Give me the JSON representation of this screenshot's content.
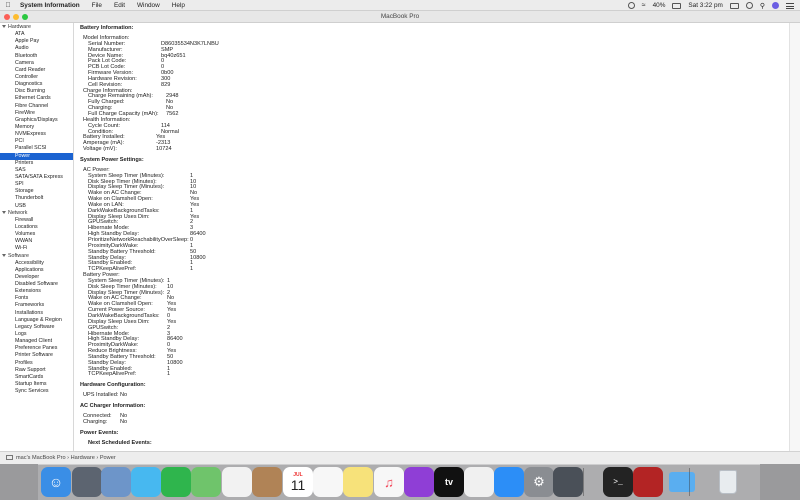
{
  "menubar": {
    "apple": "",
    "app_name": "System Information",
    "menus": [
      "File",
      "Edit",
      "Window",
      "Help"
    ],
    "battery": "40%",
    "clock": "Sat 3:22 pm"
  },
  "window": {
    "title": "MacBook Pro"
  },
  "sidebar": [
    {
      "label": "Hardware",
      "type": "group"
    },
    {
      "label": "ATA"
    },
    {
      "label": "Apple Pay"
    },
    {
      "label": "Audio"
    },
    {
      "label": "Bluetooth"
    },
    {
      "label": "Camera"
    },
    {
      "label": "Card Reader"
    },
    {
      "label": "Controller"
    },
    {
      "label": "Diagnostics"
    },
    {
      "label": "Disc Burning"
    },
    {
      "label": "Ethernet Cards"
    },
    {
      "label": "Fibre Channel"
    },
    {
      "label": "FireWire"
    },
    {
      "label": "Graphics/Displays"
    },
    {
      "label": "Memory"
    },
    {
      "label": "NVMExpress"
    },
    {
      "label": "PCI"
    },
    {
      "label": "Parallel SCSI"
    },
    {
      "label": "Power",
      "selected": true
    },
    {
      "label": "Printers"
    },
    {
      "label": "SAS"
    },
    {
      "label": "SATA/SATA Express"
    },
    {
      "label": "SPI"
    },
    {
      "label": "Storage"
    },
    {
      "label": "Thunderbolt"
    },
    {
      "label": "USB"
    },
    {
      "label": "Network",
      "type": "group"
    },
    {
      "label": "Firewall"
    },
    {
      "label": "Locations"
    },
    {
      "label": "Volumes"
    },
    {
      "label": "WWAN"
    },
    {
      "label": "Wi-Fi"
    },
    {
      "label": "Software",
      "type": "group"
    },
    {
      "label": "Accessibility"
    },
    {
      "label": "Applications"
    },
    {
      "label": "Developer"
    },
    {
      "label": "Disabled Software"
    },
    {
      "label": "Extensions"
    },
    {
      "label": "Fonts"
    },
    {
      "label": "Frameworks"
    },
    {
      "label": "Installations"
    },
    {
      "label": "Language & Region"
    },
    {
      "label": "Legacy Software"
    },
    {
      "label": "Logs"
    },
    {
      "label": "Managed Client"
    },
    {
      "label": "Preference Panes"
    },
    {
      "label": "Printer Software"
    },
    {
      "label": "Profiles"
    },
    {
      "label": "Raw Support"
    },
    {
      "label": "SmartCards"
    },
    {
      "label": "Startup Items"
    },
    {
      "label": "Sync Services"
    }
  ],
  "content": {
    "battery_title": "Battery Information:",
    "battery": [
      {
        "k": "Model Information:",
        "v": "",
        "lvl": 1
      },
      {
        "k": "Serial Number:",
        "v": "D86035534N3K7LNBU",
        "lvl": 2
      },
      {
        "k": "Manufacturer:",
        "v": "SMP",
        "lvl": 2
      },
      {
        "k": "Device Name:",
        "v": "bq40z651",
        "lvl": 2
      },
      {
        "k": "Pack Lot Code:",
        "v": "0",
        "lvl": 2
      },
      {
        "k": "PCB Lot Code:",
        "v": "0",
        "lvl": 2
      },
      {
        "k": "Firmware Version:",
        "v": "0b00",
        "lvl": 2
      },
      {
        "k": "Hardware Revision:",
        "v": "300",
        "lvl": 2
      },
      {
        "k": "Cell Revision:",
        "v": "829",
        "lvl": 2
      },
      {
        "k": "Charge Information:",
        "v": "",
        "lvl": 1
      },
      {
        "k": "Charge Remaining (mAh):",
        "v": "2948",
        "lvl": 3
      },
      {
        "k": "Fully Charged:",
        "v": "No",
        "lvl": 3
      },
      {
        "k": "Charging:",
        "v": "No",
        "lvl": 3
      },
      {
        "k": "Full Charge Capacity (mAh):",
        "v": "7562",
        "lvl": 3
      },
      {
        "k": "Health Information:",
        "v": "",
        "lvl": 1
      },
      {
        "k": "Cycle Count:",
        "v": "114",
        "lvl": 2
      },
      {
        "k": "Condition:",
        "v": "Normal",
        "lvl": 2
      },
      {
        "k": "Battery Installed:",
        "v": "Yes",
        "lvl": 1
      },
      {
        "k": "Amperage (mA):",
        "v": "-2313",
        "lvl": 1
      },
      {
        "k": "Voltage (mV):",
        "v": "10724",
        "lvl": 1
      }
    ],
    "power_title": "System Power Settings:",
    "ac_power_label": "AC Power:",
    "ac_power": [
      {
        "k": "System Sleep Timer (Minutes):",
        "v": "1"
      },
      {
        "k": "Disk Sleep Timer (Minutes):",
        "v": "10"
      },
      {
        "k": "Display Sleep Timer (Minutes):",
        "v": "10"
      },
      {
        "k": "Wake on AC Change:",
        "v": "No"
      },
      {
        "k": "Wake on Clamshell Open:",
        "v": "Yes"
      },
      {
        "k": "Wake on LAN:",
        "v": "Yes"
      },
      {
        "k": "DarkWakeBackgroundTasks:",
        "v": "1"
      },
      {
        "k": "Display Sleep Uses Dim:",
        "v": "Yes"
      },
      {
        "k": "GPUSwitch:",
        "v": "2"
      },
      {
        "k": "Hibernate Mode:",
        "v": "3"
      },
      {
        "k": "High Standby Delay:",
        "v": "86400"
      },
      {
        "k": "PrioritizeNetworkReachabilityOverSleep:",
        "v": "0"
      },
      {
        "k": "ProximityDarkWake:",
        "v": "1"
      },
      {
        "k": "Standby Battery Threshold:",
        "v": "50"
      },
      {
        "k": "Standby Delay:",
        "v": "10800"
      },
      {
        "k": "Standby Enabled:",
        "v": "1"
      },
      {
        "k": "TCPKeepAlivePref:",
        "v": "1"
      }
    ],
    "battery_power_label": "Battery Power:",
    "battery_power": [
      {
        "k": "System Sleep Timer (Minutes):",
        "v": "1"
      },
      {
        "k": "Disk Sleep Timer (Minutes):",
        "v": "10"
      },
      {
        "k": "Display Sleep Timer (Minutes):",
        "v": "2"
      },
      {
        "k": "Wake on AC Change:",
        "v": "No"
      },
      {
        "k": "Wake on Clamshell Open:",
        "v": "Yes"
      },
      {
        "k": "Current Power Source:",
        "v": "Yes"
      },
      {
        "k": "DarkWakeBackgroundTasks:",
        "v": "0"
      },
      {
        "k": "Display Sleep Uses Dim:",
        "v": "Yes"
      },
      {
        "k": "GPUSwitch:",
        "v": "2"
      },
      {
        "k": "Hibernate Mode:",
        "v": "3"
      },
      {
        "k": "High Standby Delay:",
        "v": "86400"
      },
      {
        "k": "ProximityDarkWake:",
        "v": "0"
      },
      {
        "k": "Reduce Brightness:",
        "v": "Yes"
      },
      {
        "k": "Standby Battery Threshold:",
        "v": "50"
      },
      {
        "k": "Standby Delay:",
        "v": "10800"
      },
      {
        "k": "Standby Enabled:",
        "v": "1"
      },
      {
        "k": "TCPKeepAlivePref:",
        "v": "1"
      }
    ],
    "hardware_title": "Hardware Configuration:",
    "hardware": [
      {
        "k": "UPS Installed:",
        "v": "No"
      }
    ],
    "charger_title": "AC Charger Information:",
    "charger": [
      {
        "k": "Connected:",
        "v": "No"
      },
      {
        "k": "Charging:",
        "v": "No"
      }
    ],
    "events_title": "Power Events:",
    "events_partial": "Next Scheduled Events:"
  },
  "statusbar": {
    "path": [
      "mac's MacBook Pro",
      "Hardware",
      "Power"
    ],
    "separator": "›"
  },
  "dock": {
    "colors": {
      "bg": "#9a9a9c"
    },
    "apps": [
      {
        "name": "finder-icon",
        "color": "#3a8ee6"
      },
      {
        "name": "launchpad-icon",
        "color": "#5c6470"
      },
      {
        "name": "preview-icon",
        "color": "#6d95c9"
      },
      {
        "name": "messages-icon",
        "color": "#47b8f0"
      },
      {
        "name": "facetime-icon",
        "color": "#2fb54d"
      },
      {
        "name": "maps-icon",
        "color": "#6fc46b"
      },
      {
        "name": "photos-icon",
        "color": "#f2f2f2"
      },
      {
        "name": "contacts-icon",
        "color": "#b08356"
      },
      {
        "name": "calendar-icon",
        "color": "#ffffff"
      },
      {
        "name": "reminders-icon",
        "color": "#f7f7f7"
      },
      {
        "name": "notes-icon",
        "color": "#f7e27a"
      },
      {
        "name": "music-icon",
        "color": "#f7f7f7"
      },
      {
        "name": "podcasts-icon",
        "color": "#8f3ed6"
      },
      {
        "name": "tv-icon",
        "color": "#111111"
      },
      {
        "name": "news-icon",
        "color": "#f0f0f0"
      },
      {
        "name": "app-store-icon",
        "color": "#2c8ef7"
      },
      {
        "name": "system-preferences-icon",
        "color": "#8a8d92"
      },
      {
        "name": "system-information-icon",
        "color": "#4a5058"
      },
      {
        "name": "terminal-icon",
        "color": "#232323"
      },
      {
        "name": "photo-booth-icon",
        "color": "#b32424"
      },
      {
        "name": "folder-icon",
        "color": "#5aaef0"
      },
      {
        "name": "trash-icon",
        "color": "#d7dbe0"
      }
    ],
    "calendar_day": "11",
    "calendar_month": "JUL",
    "tv_label": "tv"
  }
}
